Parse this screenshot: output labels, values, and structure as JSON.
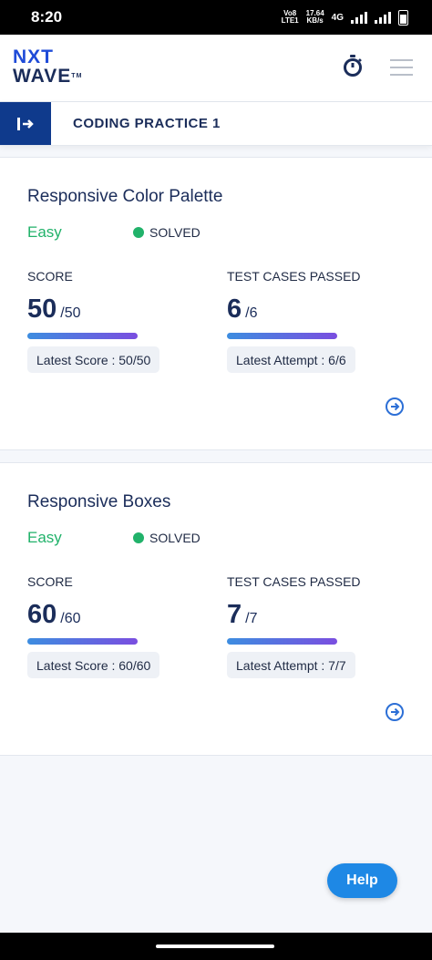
{
  "status_bar": {
    "time": "8:20",
    "indicators": [
      "Vo8 LTE1",
      "17.64 KB/s",
      "4G"
    ],
    "volte": "Vo8\nLTE1",
    "speed": "17.64\nKB/s",
    "network": "4G"
  },
  "header": {
    "logo_line1": "NXT",
    "logo_line2": "WAVE",
    "logo_tm": "TM",
    "timer_icon": "stopwatch-icon",
    "menu_icon": "hamburger-icon"
  },
  "practice_bar": {
    "title": "CODING PRACTICE 1",
    "toggle_icon": "collapse-sidebar-icon"
  },
  "problems": [
    {
      "title": "Responsive Color Palette",
      "difficulty": "Easy",
      "status": "SOLVED",
      "score_label": "SCORE",
      "score": "50",
      "score_total": "/50",
      "tests_label": "TEST CASES PASSED",
      "tests": "6",
      "tests_total": "/6",
      "latest_score": "Latest Score : 50/50",
      "latest_attempt": "Latest Attempt : 6/6"
    },
    {
      "title": "Responsive Boxes",
      "difficulty": "Easy",
      "status": "SOLVED",
      "score_label": "SCORE",
      "score": "60",
      "score_total": "/60",
      "tests_label": "TEST CASES PASSED",
      "tests": "7",
      "tests_total": "/7",
      "latest_score": "Latest Score : 60/60",
      "latest_attempt": "Latest Attempt : 7/7"
    }
  ],
  "help": {
    "label": "Help"
  },
  "colors": {
    "brand_blue": "#0f3a8c",
    "easy_green": "#21b26a",
    "help_blue": "#1e88e5"
  }
}
